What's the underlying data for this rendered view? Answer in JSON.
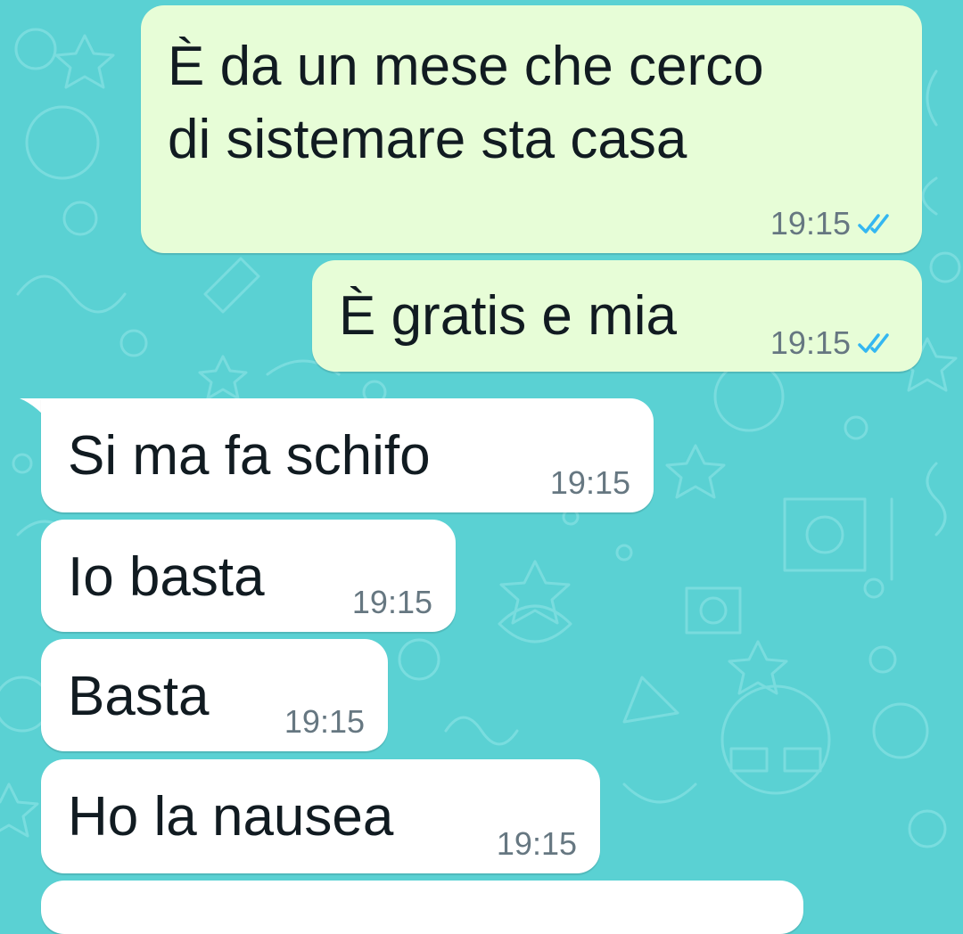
{
  "chat": {
    "messages": [
      {
        "direction": "out",
        "text": "È da un mese che cerco\ndi sistemare sta casa",
        "time": "19:15",
        "status": "read-double-check-icon"
      },
      {
        "direction": "out",
        "text": "È gratis e mia",
        "time": "19:15",
        "status": "read-double-check-icon"
      },
      {
        "direction": "in",
        "text": "Si ma fa schifo",
        "time": "19:15"
      },
      {
        "direction": "in",
        "text": "Io basta",
        "time": "19:15"
      },
      {
        "direction": "in",
        "text": "Basta",
        "time": "19:15"
      },
      {
        "direction": "in",
        "text": "Ho la nausea",
        "time": "19:15"
      }
    ]
  },
  "colors": {
    "wallpaper": "#5ad1d3",
    "outgoing_bubble": "#e7fdd7",
    "incoming_bubble": "#ffffff",
    "read_ticks": "#34b7f1",
    "timestamp": "#667781"
  }
}
